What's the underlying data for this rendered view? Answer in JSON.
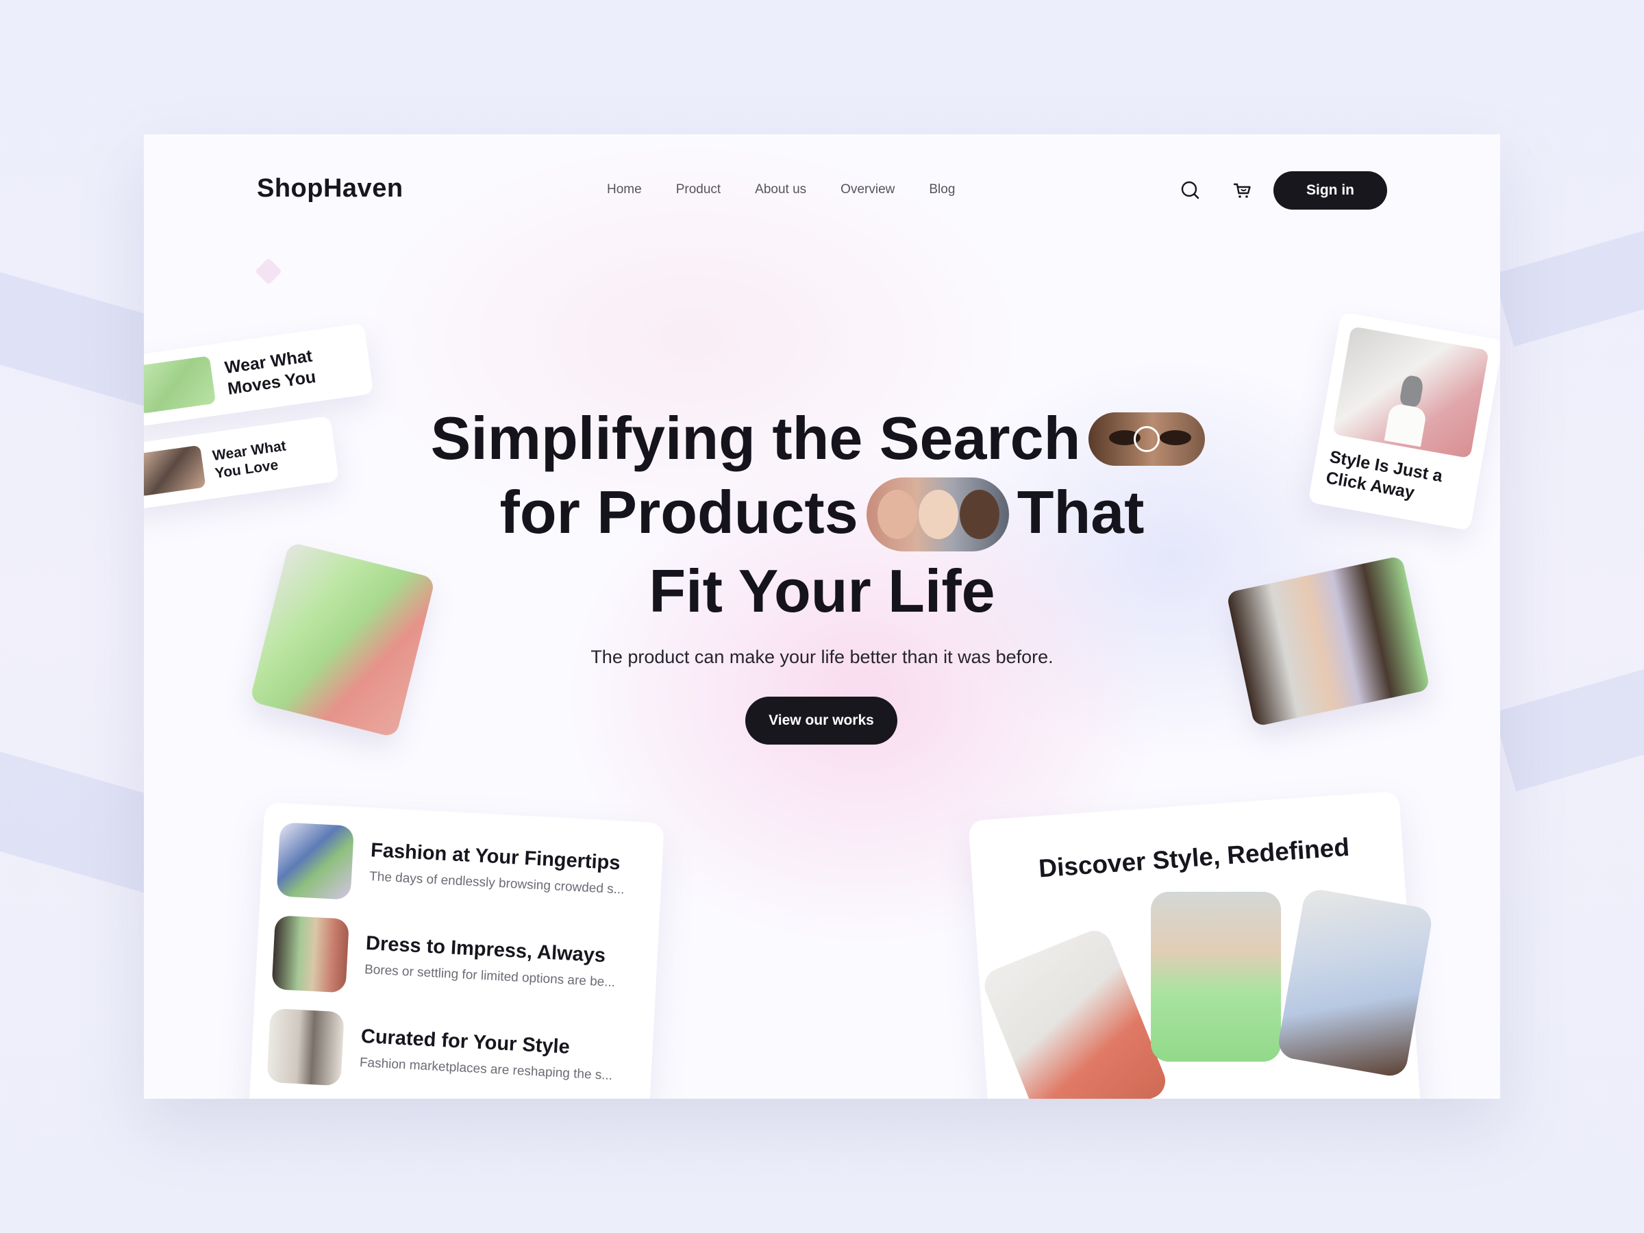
{
  "brand": {
    "logo": "ShopHaven"
  },
  "nav": {
    "items": [
      {
        "label": "Home"
      },
      {
        "label": "Product"
      },
      {
        "label": "About us"
      },
      {
        "label": "Overview"
      },
      {
        "label": "Blog"
      }
    ],
    "search_icon": "search-icon",
    "cart_icon": "cart-icon",
    "signin_label": "Sign in"
  },
  "hero": {
    "line1": "Simplifying the Search",
    "line2a": "for Products",
    "line2b": "That",
    "line3": "Fit Your Life",
    "subtitle": "The product can make your life better than it was before.",
    "cta_label": "View our works"
  },
  "floating": {
    "tag1": "Wear What Moves You",
    "tag2": "Wear What You Love",
    "style_card": "Style Is Just a Click Away"
  },
  "features": [
    {
      "title": "Fashion at Your Fingertips",
      "desc": "The days of endlessly browsing crowded s..."
    },
    {
      "title": "Dress to Impress, Always",
      "desc": "Bores or settling for limited options are be..."
    },
    {
      "title": "Curated for Your Style",
      "desc": "Fashion marketplaces are reshaping the s..."
    }
  ],
  "discover": {
    "title": "Discover Style, Redefined"
  },
  "colors": {
    "primary": "#18171d",
    "background": "#fbfaff",
    "accent_pink": "#f8d6ec",
    "accent_lavender": "#e2e4fa"
  }
}
